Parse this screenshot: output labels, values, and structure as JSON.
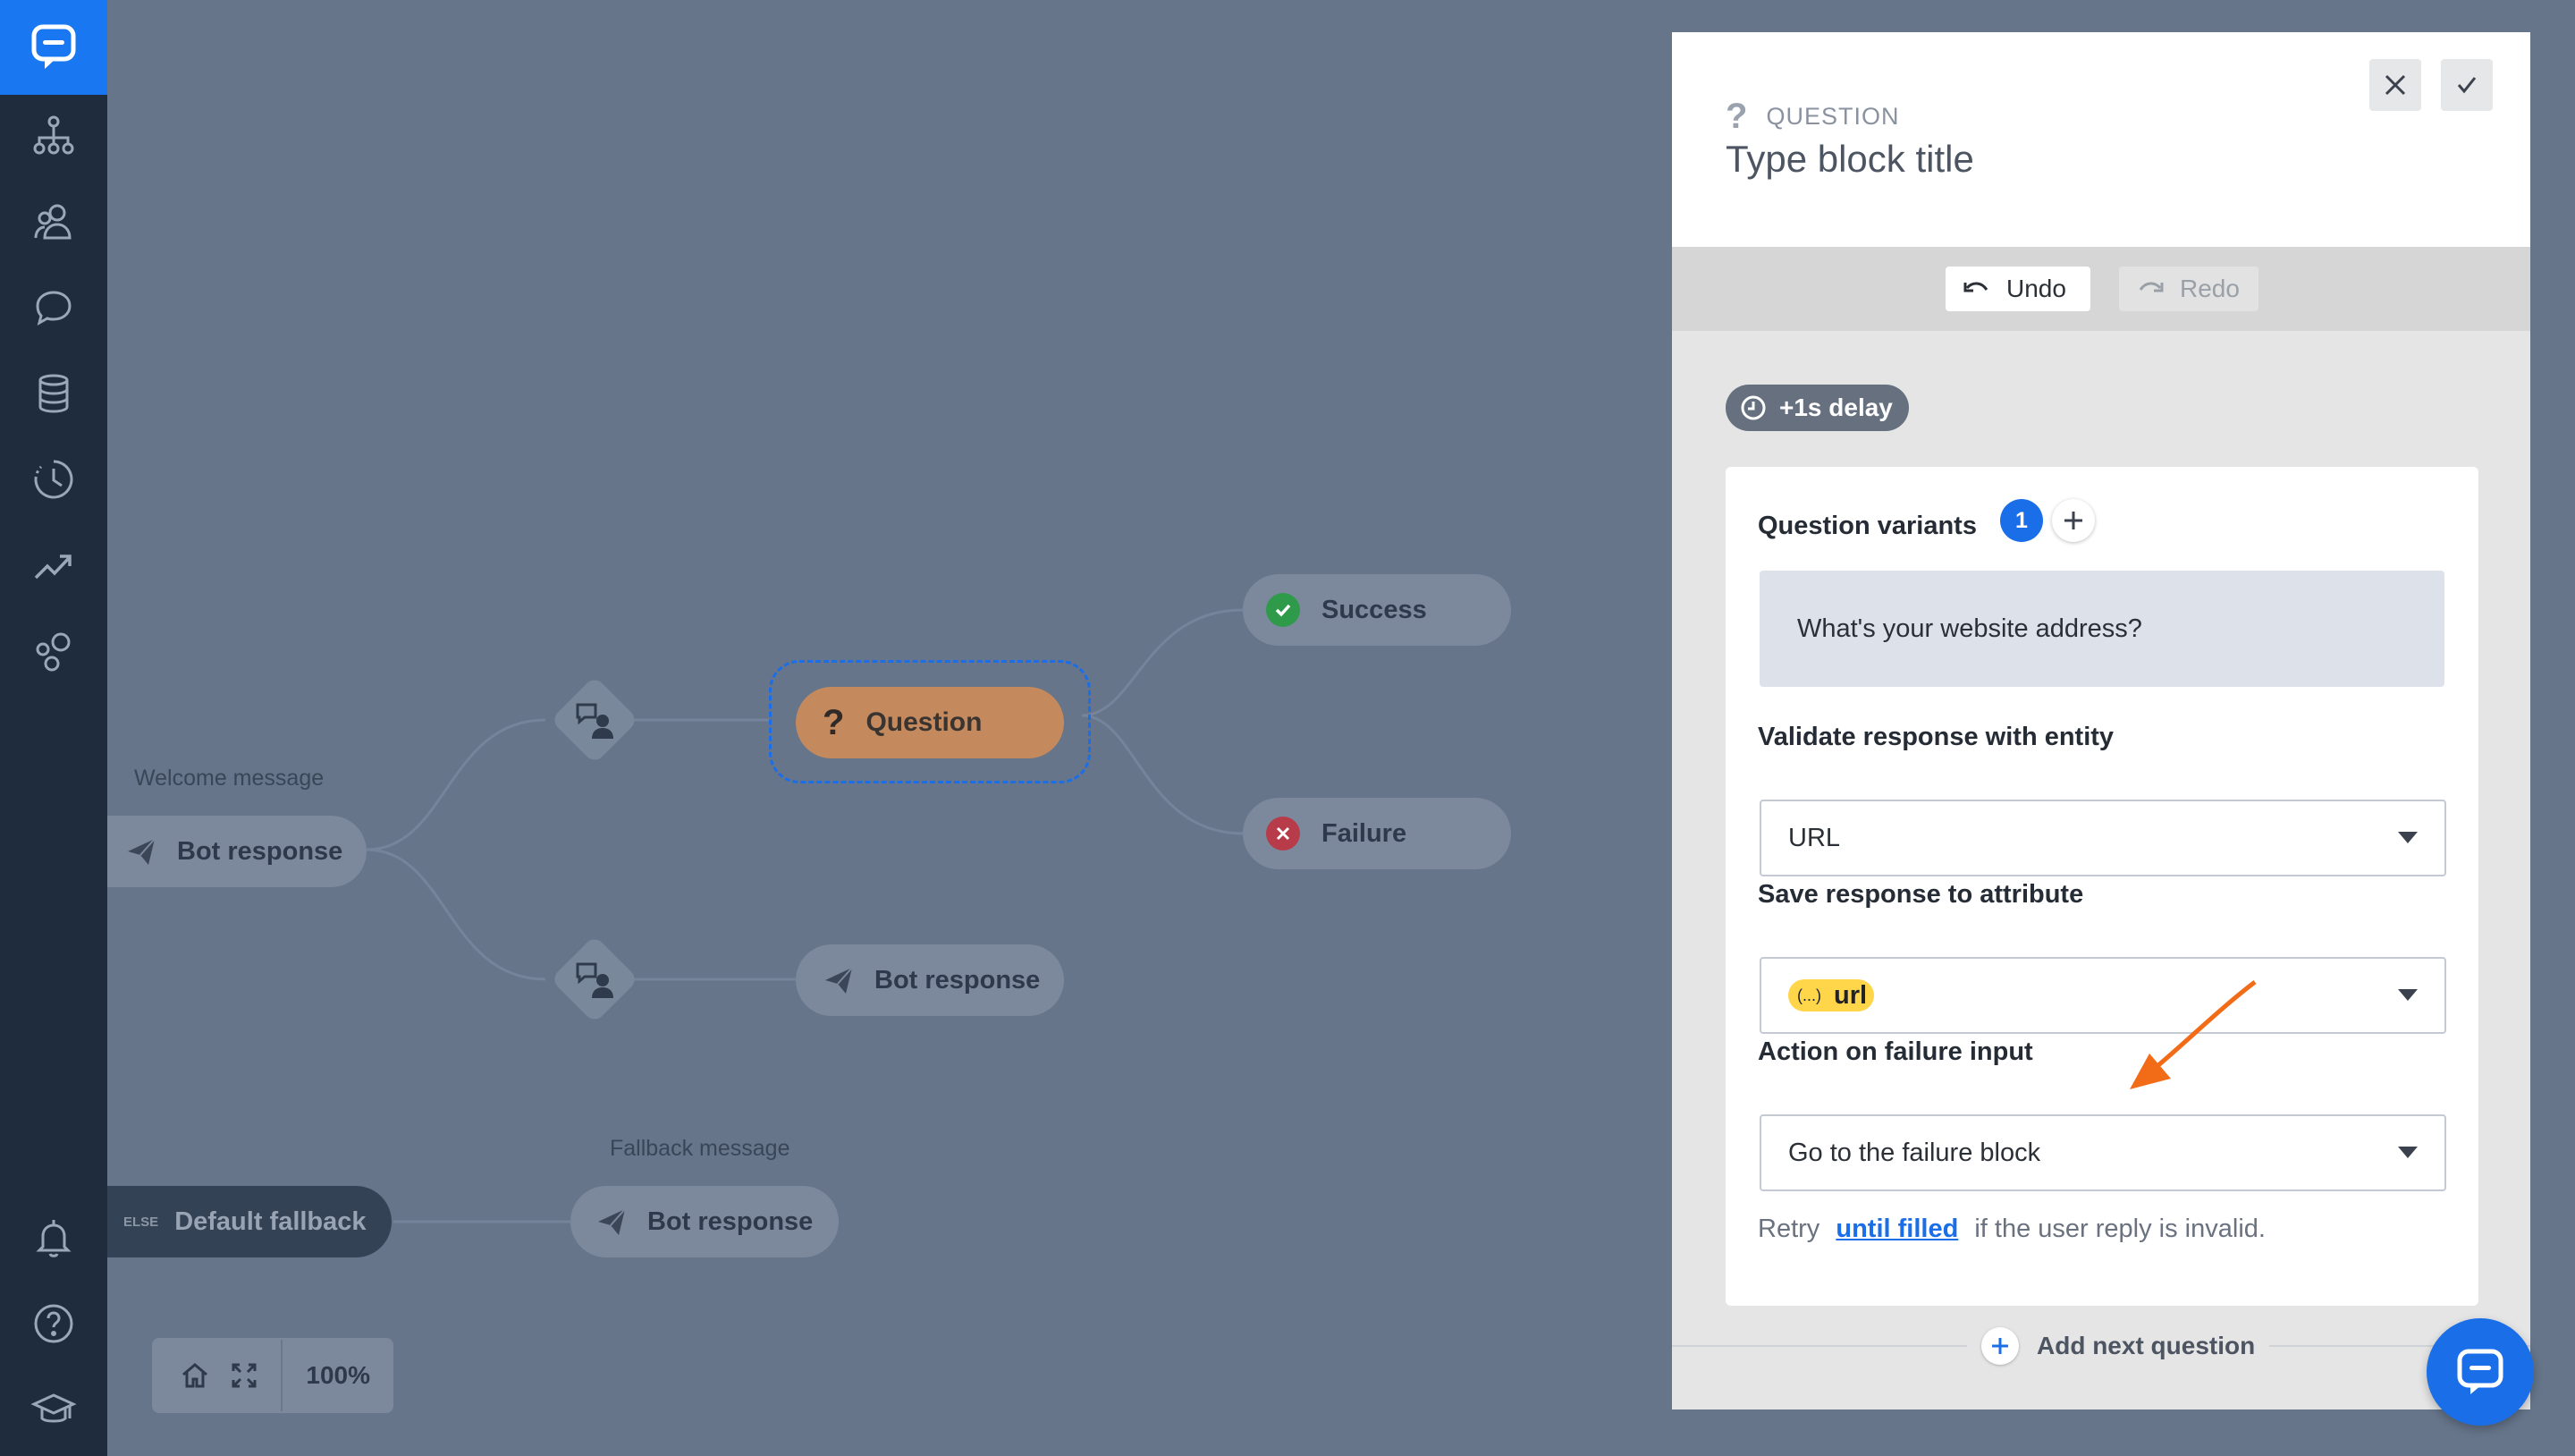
{
  "colors": {
    "sidebar": "#1f2c3d",
    "brand": "#1a77f2",
    "canvas": "#66758a",
    "accent": "#1a6ee8",
    "question": "#c48a5e",
    "attribute": "#ffd54a",
    "arrow": "#f26b16"
  },
  "sidebar": {
    "logo": "chat-logo-icon",
    "items": [
      "sitemap-icon",
      "users-icon",
      "chat-bubble-icon",
      "database-icon",
      "history-icon",
      "trend-icon",
      "bubbles-icon"
    ],
    "bottom_items": [
      "bell-icon",
      "help-icon",
      "graduation-cap-icon"
    ]
  },
  "canvas": {
    "welcome_label": "Welcome message",
    "welcome_node": "Bot response",
    "question_node": "Question",
    "success_node": "Success",
    "failure_node": "Failure",
    "bot_response_node": "Bot response",
    "fallback_label": "Fallback message",
    "else_tag": "ELSE",
    "default_fallback_node": "Default fallback",
    "fallback_node": "Bot response",
    "zoom": "100%"
  },
  "panel": {
    "type_label": "QUESTION",
    "title_placeholder": "Type block title",
    "undo_label": "Undo",
    "redo_label": "Redo",
    "delay_label": "+1s delay",
    "variants_label": "Question variants",
    "variants_count": "1",
    "variant_text": "What's your website address?",
    "validate_label": "Validate response with entity",
    "validate_value": "URL",
    "save_label": "Save response to attribute",
    "save_attr_symbol": "(...)",
    "save_value": "url",
    "action_label": "Action on failure input",
    "action_value": "Go to the failure block",
    "retry_prefix": "Retry",
    "retry_link": "until filled",
    "retry_suffix": "if the user reply is invalid.",
    "add_next_label": "Add next question"
  }
}
